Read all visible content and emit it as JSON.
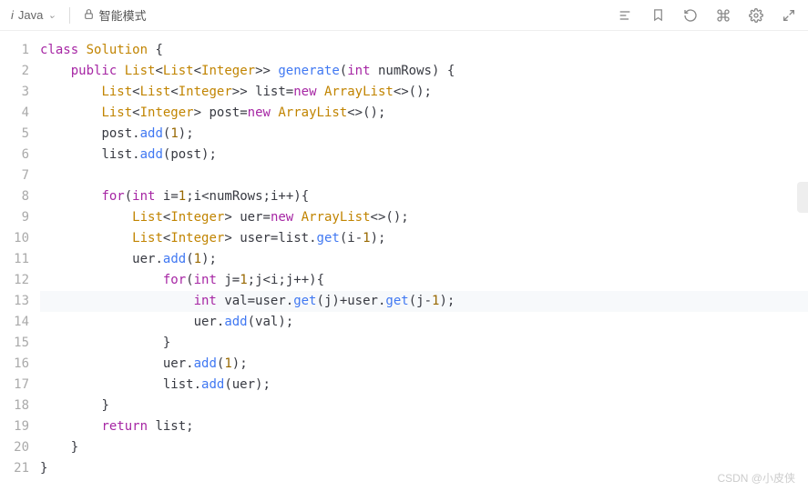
{
  "toolbar": {
    "language_prefix": "i",
    "language": "Java",
    "mode_label": "智能模式"
  },
  "watermark": "CSDN @小皮侠",
  "code": {
    "lines": [
      {
        "n": 1,
        "indent": 0,
        "tokens": [
          [
            "kw",
            "class"
          ],
          [
            "sp",
            " "
          ],
          [
            "type",
            "Solution"
          ],
          [
            "sp",
            " "
          ],
          [
            "punc",
            "{"
          ]
        ]
      },
      {
        "n": 2,
        "indent": 1,
        "tokens": [
          [
            "kw",
            "public"
          ],
          [
            "sp",
            " "
          ],
          [
            "type",
            "List"
          ],
          [
            "punc",
            "<"
          ],
          [
            "type",
            "List"
          ],
          [
            "punc",
            "<"
          ],
          [
            "type",
            "Integer"
          ],
          [
            "punc",
            ">>"
          ],
          [
            "sp",
            " "
          ],
          [
            "fn",
            "generate"
          ],
          [
            "punc",
            "("
          ],
          [
            "kw",
            "int"
          ],
          [
            "sp",
            " "
          ],
          [
            "ident",
            "numRows"
          ],
          [
            "punc",
            ")"
          ],
          [
            "sp",
            " "
          ],
          [
            "punc",
            "{"
          ]
        ]
      },
      {
        "n": 3,
        "indent": 2,
        "tokens": [
          [
            "type",
            "List"
          ],
          [
            "punc",
            "<"
          ],
          [
            "type",
            "List"
          ],
          [
            "punc",
            "<"
          ],
          [
            "type",
            "Integer"
          ],
          [
            "punc",
            ">>"
          ],
          [
            "sp",
            " "
          ],
          [
            "ident",
            "list"
          ],
          [
            "op",
            "="
          ],
          [
            "kw",
            "new"
          ],
          [
            "sp",
            " "
          ],
          [
            "type",
            "ArrayList"
          ],
          [
            "punc",
            "<>();"
          ]
        ]
      },
      {
        "n": 4,
        "indent": 2,
        "tokens": [
          [
            "type",
            "List"
          ],
          [
            "punc",
            "<"
          ],
          [
            "type",
            "Integer"
          ],
          [
            "punc",
            ">"
          ],
          [
            "sp",
            " "
          ],
          [
            "ident",
            "post"
          ],
          [
            "op",
            "="
          ],
          [
            "kw",
            "new"
          ],
          [
            "sp",
            " "
          ],
          [
            "type",
            "ArrayList"
          ],
          [
            "punc",
            "<>();"
          ]
        ]
      },
      {
        "n": 5,
        "indent": 2,
        "tokens": [
          [
            "ident",
            "post"
          ],
          [
            "punc",
            "."
          ],
          [
            "fn",
            "add"
          ],
          [
            "punc",
            "("
          ],
          [
            "num",
            "1"
          ],
          [
            "punc",
            ");"
          ]
        ]
      },
      {
        "n": 6,
        "indent": 2,
        "tokens": [
          [
            "ident",
            "list"
          ],
          [
            "punc",
            "."
          ],
          [
            "fn",
            "add"
          ],
          [
            "punc",
            "("
          ],
          [
            "ident",
            "post"
          ],
          [
            "punc",
            ");"
          ]
        ]
      },
      {
        "n": 7,
        "indent": 0,
        "tokens": []
      },
      {
        "n": 8,
        "indent": 2,
        "tokens": [
          [
            "kw",
            "for"
          ],
          [
            "punc",
            "("
          ],
          [
            "kw",
            "int"
          ],
          [
            "sp",
            " "
          ],
          [
            "ident",
            "i"
          ],
          [
            "op",
            "="
          ],
          [
            "num",
            "1"
          ],
          [
            "punc",
            ";"
          ],
          [
            "ident",
            "i"
          ],
          [
            "op",
            "<"
          ],
          [
            "ident",
            "numRows"
          ],
          [
            "punc",
            ";"
          ],
          [
            "ident",
            "i"
          ],
          [
            "op",
            "++"
          ],
          [
            "punc",
            ")"
          ],
          [
            "punc",
            "{"
          ]
        ]
      },
      {
        "n": 9,
        "indent": 3,
        "tokens": [
          [
            "type",
            "List"
          ],
          [
            "punc",
            "<"
          ],
          [
            "type",
            "Integer"
          ],
          [
            "punc",
            ">"
          ],
          [
            "sp",
            " "
          ],
          [
            "ident",
            "uer"
          ],
          [
            "op",
            "="
          ],
          [
            "kw",
            "new"
          ],
          [
            "sp",
            " "
          ],
          [
            "type",
            "ArrayList"
          ],
          [
            "punc",
            "<>();"
          ]
        ]
      },
      {
        "n": 10,
        "indent": 3,
        "tokens": [
          [
            "type",
            "List"
          ],
          [
            "punc",
            "<"
          ],
          [
            "type",
            "Integer"
          ],
          [
            "punc",
            ">"
          ],
          [
            "sp",
            " "
          ],
          [
            "ident",
            "user"
          ],
          [
            "op",
            "="
          ],
          [
            "ident",
            "list"
          ],
          [
            "punc",
            "."
          ],
          [
            "fn",
            "get"
          ],
          [
            "punc",
            "("
          ],
          [
            "ident",
            "i"
          ],
          [
            "op",
            "-"
          ],
          [
            "num",
            "1"
          ],
          [
            "punc",
            ");"
          ]
        ]
      },
      {
        "n": 11,
        "indent": 3,
        "tokens": [
          [
            "ident",
            "uer"
          ],
          [
            "punc",
            "."
          ],
          [
            "fn",
            "add"
          ],
          [
            "punc",
            "("
          ],
          [
            "num",
            "1"
          ],
          [
            "punc",
            ");"
          ]
        ]
      },
      {
        "n": 12,
        "indent": 4,
        "tokens": [
          [
            "kw",
            "for"
          ],
          [
            "punc",
            "("
          ],
          [
            "kw",
            "int"
          ],
          [
            "sp",
            " "
          ],
          [
            "ident",
            "j"
          ],
          [
            "op",
            "="
          ],
          [
            "num",
            "1"
          ],
          [
            "punc",
            ";"
          ],
          [
            "ident",
            "j"
          ],
          [
            "op",
            "<"
          ],
          [
            "ident",
            "i"
          ],
          [
            "punc",
            ";"
          ],
          [
            "ident",
            "j"
          ],
          [
            "op",
            "++"
          ],
          [
            "punc",
            ")"
          ],
          [
            "punc",
            "{"
          ]
        ]
      },
      {
        "n": 13,
        "indent": 5,
        "hl": true,
        "tokens": [
          [
            "kw",
            "int"
          ],
          [
            "sp",
            " "
          ],
          [
            "ident",
            "val"
          ],
          [
            "op",
            "="
          ],
          [
            "ident",
            "user"
          ],
          [
            "punc",
            "."
          ],
          [
            "fn",
            "get"
          ],
          [
            "punc",
            "("
          ],
          [
            "ident",
            "j"
          ],
          [
            "punc",
            ")"
          ],
          [
            "op",
            "+"
          ],
          [
            "ident",
            "user"
          ],
          [
            "punc",
            "."
          ],
          [
            "fn",
            "get"
          ],
          [
            "punc",
            "("
          ],
          [
            "ident",
            "j"
          ],
          [
            "op",
            "-"
          ],
          [
            "num",
            "1"
          ],
          [
            "punc",
            ");"
          ]
        ]
      },
      {
        "n": 14,
        "indent": 5,
        "tokens": [
          [
            "ident",
            "uer"
          ],
          [
            "punc",
            "."
          ],
          [
            "fn",
            "add"
          ],
          [
            "punc",
            "("
          ],
          [
            "ident",
            "val"
          ],
          [
            "punc",
            ");"
          ]
        ]
      },
      {
        "n": 15,
        "indent": 4,
        "tokens": [
          [
            "punc",
            "}"
          ]
        ]
      },
      {
        "n": 16,
        "indent": 4,
        "tokens": [
          [
            "ident",
            "uer"
          ],
          [
            "punc",
            "."
          ],
          [
            "fn",
            "add"
          ],
          [
            "punc",
            "("
          ],
          [
            "num",
            "1"
          ],
          [
            "punc",
            ");"
          ]
        ]
      },
      {
        "n": 17,
        "indent": 4,
        "tokens": [
          [
            "ident",
            "list"
          ],
          [
            "punc",
            "."
          ],
          [
            "fn",
            "add"
          ],
          [
            "punc",
            "("
          ],
          [
            "ident",
            "uer"
          ],
          [
            "punc",
            ");"
          ]
        ]
      },
      {
        "n": 18,
        "indent": 2,
        "tokens": [
          [
            "punc",
            "}"
          ]
        ]
      },
      {
        "n": 19,
        "indent": 2,
        "tokens": [
          [
            "kw",
            "return"
          ],
          [
            "sp",
            " "
          ],
          [
            "ident",
            "list"
          ],
          [
            "punc",
            ";"
          ]
        ]
      },
      {
        "n": 20,
        "indent": 1,
        "tokens": [
          [
            "punc",
            "}"
          ]
        ]
      },
      {
        "n": 21,
        "indent": 0,
        "tokens": [
          [
            "punc",
            "}"
          ]
        ]
      }
    ]
  }
}
